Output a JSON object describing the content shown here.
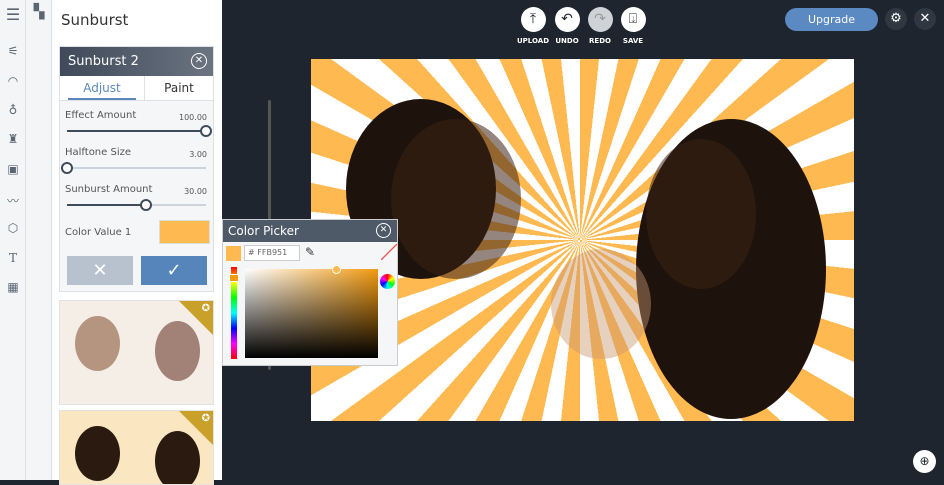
{
  "sidebar": {
    "icons": [
      "menu-icon",
      "adjust-sliders-icon",
      "lips-icon",
      "light-bulb-icon",
      "brush-icon",
      "frame-icon",
      "mustache-icon",
      "sticker-icon",
      "text-icon",
      "texture-icon"
    ],
    "grid_icon": "grid-icon"
  },
  "panel": {
    "title": "Sunburst",
    "card_title": "Sunburst 2",
    "tabs": [
      "Adjust",
      "Paint"
    ],
    "sliders": [
      {
        "label": "Effect Amount",
        "value": "100.00",
        "fraction": 1.0
      },
      {
        "label": "Halftone Size",
        "value": "3.00",
        "fraction": 0.0
      },
      {
        "label": "Sunburst Amount",
        "value": "30.00",
        "fraction": 0.57
      }
    ],
    "color_label": "Color Value 1",
    "color": "#FFB951",
    "cancel": "✕",
    "apply": "✓"
  },
  "toolbar": {
    "upload": "UPLOAD",
    "undo": "UNDO",
    "redo": "REDO",
    "save": "SAVE",
    "upgrade": "Upgrade"
  },
  "color_picker": {
    "title": "Color Picker",
    "hex": "# FFB951"
  },
  "colors": {
    "accent": "#5b89c2",
    "ray": "#FFB951"
  }
}
